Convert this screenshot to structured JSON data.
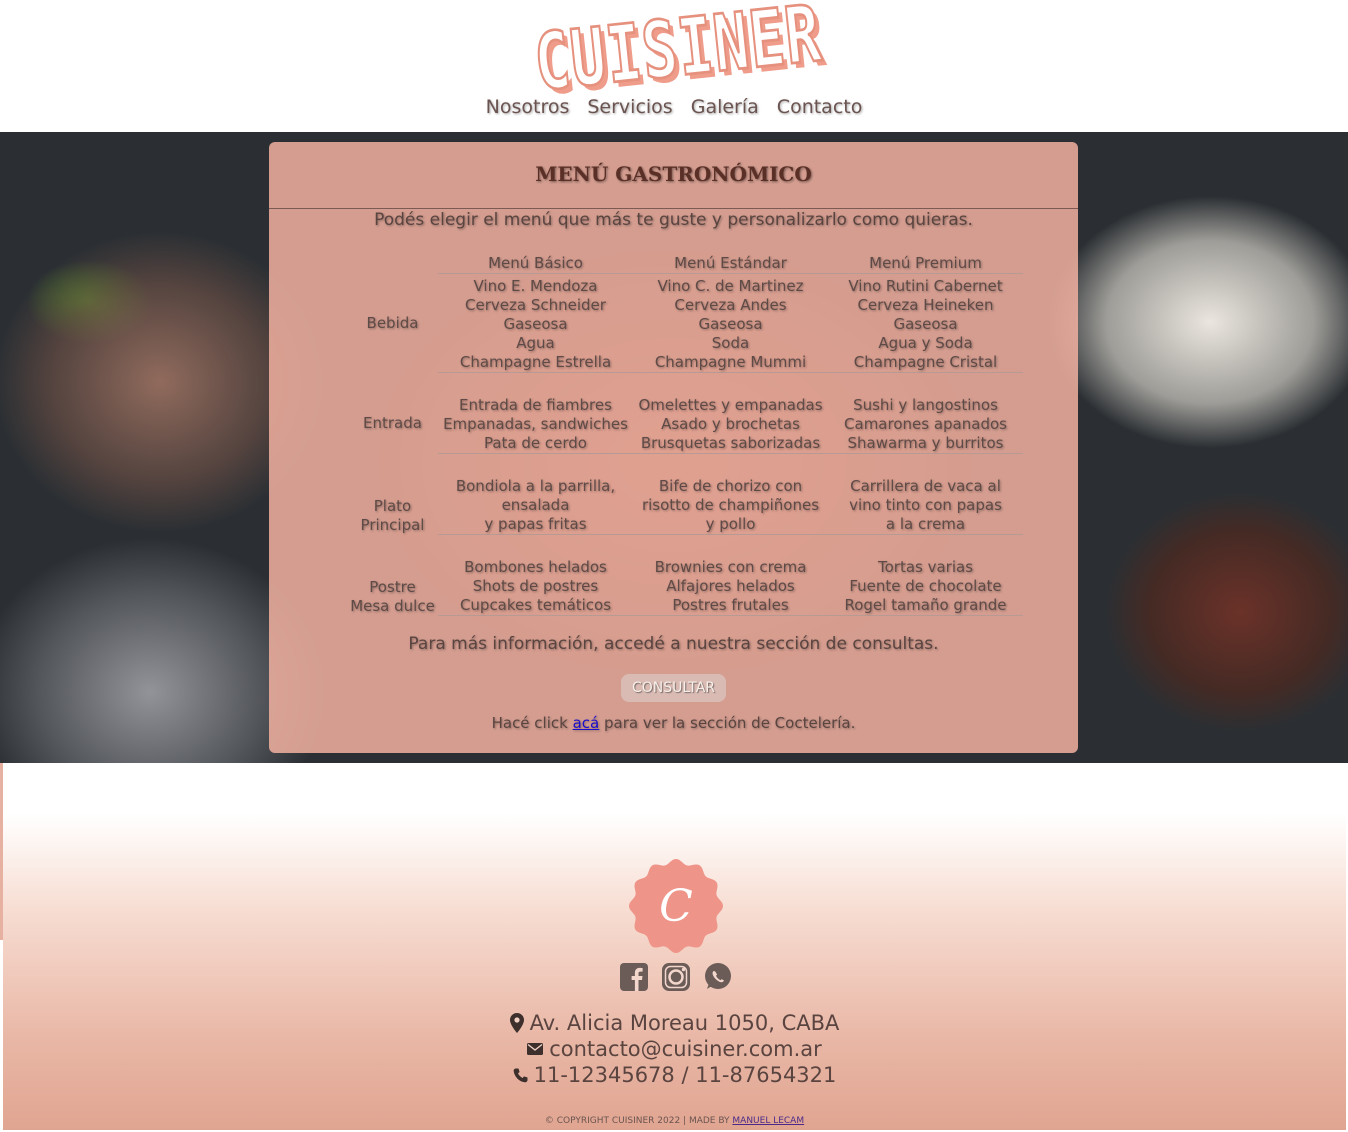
{
  "brand": {
    "logo_text": "CUISINER",
    "accent_color": "#e6907e"
  },
  "nav": {
    "items": [
      "Nosotros",
      "Servicios",
      "Galería",
      "Contacto"
    ]
  },
  "menu_panel": {
    "title": "MENÚ GASTRONÓMICO",
    "intro": "Podés elegir el menú que más te guste y personalizarlo como quieras.",
    "columns": [
      "Menú Básico",
      "Menú Estándar",
      "Menú Premium"
    ],
    "rows": [
      {
        "label": [
          "Bebida"
        ],
        "cells": [
          [
            "Vino E. Mendoza",
            "Cerveza Schneider",
            "Gaseosa",
            "Agua",
            "Champagne Estrella"
          ],
          [
            "Vino C. de Martinez",
            "Cerveza Andes",
            "Gaseosa",
            "Soda",
            "Champagne Mummi"
          ],
          [
            "Vino Rutini Cabernet",
            "Cerveza Heineken",
            "Gaseosa",
            "Agua y Soda",
            "Champagne Cristal"
          ]
        ]
      },
      {
        "label": [
          "Entrada"
        ],
        "cells": [
          [
            "Entrada de fiambres",
            "Empanadas, sandwiches",
            "Pata de cerdo"
          ],
          [
            "Omelettes y empanadas",
            "Asado y brochetas",
            "Brusquetas saborizadas"
          ],
          [
            "Sushi y langostinos",
            "Camarones apanados",
            "Shawarma y burritos"
          ]
        ]
      },
      {
        "label": [
          "Plato",
          "Principal"
        ],
        "cells": [
          [
            "Bondiola a la parrilla,",
            "ensalada",
            "y papas fritas"
          ],
          [
            "Bife de chorizo con",
            "risotto de champiñones",
            "y pollo"
          ],
          [
            "Carrillera de vaca al",
            "vino tinto con papas",
            "a la crema"
          ]
        ]
      },
      {
        "label": [
          "Postre",
          "Mesa dulce"
        ],
        "cells": [
          [
            "Bombones helados",
            "Shots de postres",
            "Cupcakes temáticos"
          ],
          [
            "Brownies con crema",
            "Alfajores helados",
            "Postres frutales"
          ],
          [
            "Tortas varias",
            "Fuente de chocolate",
            "Rogel tamaño grande"
          ]
        ]
      }
    ],
    "more_info": "Para más información, accedé a nuestra sección de consultas.",
    "consult_button": "CONSULTAR",
    "cocktail_prefix": "Hacé click ",
    "cocktail_link": "acá",
    "cocktail_suffix": " para ver la sección de Coctelería."
  },
  "footer": {
    "seal_letter": "C",
    "social_icons": [
      "facebook-icon",
      "instagram-icon",
      "whatsapp-icon"
    ],
    "address": "Av. Alicia Moreau 1050, CABA",
    "email": "contacto@cuisiner.com.ar",
    "phone": "11-12345678 / 11-87654321",
    "copyright_prefix": "© COPYRIGHT CUISINER 2022 | MADE BY ",
    "copyright_author": "MANUEL LECAM"
  }
}
